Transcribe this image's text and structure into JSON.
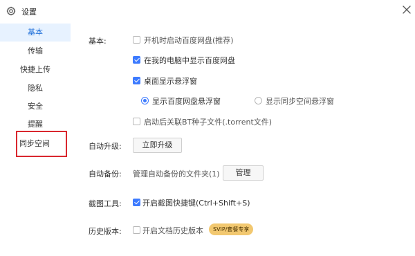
{
  "window": {
    "title": "设置"
  },
  "sidebar": {
    "items": [
      {
        "label": "基本",
        "active": true
      },
      {
        "label": "传输",
        "active": false
      },
      {
        "label": "快捷上传",
        "active": false
      },
      {
        "label": "隐私",
        "active": false
      },
      {
        "label": "安全",
        "active": false
      },
      {
        "label": "提醒",
        "active": false
      },
      {
        "label": "同步空间",
        "active": false
      }
    ]
  },
  "basic": {
    "section_label": "基本:",
    "options": [
      {
        "label": "开机时启动百度网盘(推荐)",
        "checked": false
      },
      {
        "label": "在我的电脑中显示百度网盘",
        "checked": true
      },
      {
        "label": "桌面显示悬浮窗",
        "checked": true
      }
    ],
    "float_radios": [
      {
        "label": "显示百度网盘悬浮窗",
        "selected": true
      },
      {
        "label": "显示同步空间悬浮窗",
        "selected": false
      }
    ],
    "bt_option": {
      "label": "启动后关联BT种子文件(.torrent文件)",
      "checked": false
    }
  },
  "upgrade": {
    "section_label": "自动升级:",
    "button_label": "立即升级"
  },
  "backup": {
    "section_label": "自动备份:",
    "description": "管理自动备份的文件夹(1)",
    "button_label": "管理"
  },
  "screenshot": {
    "section_label": "截图工具:",
    "option_label": "开启截图快捷键(Ctrl+Shift+S)",
    "checked": true
  },
  "history": {
    "section_label": "历史版本:",
    "option_label": "开启文档历史版本",
    "checked": false,
    "badge": "SVIP/套餐专享"
  },
  "colors": {
    "accent": "#3d7bff",
    "active_bg": "#e7f2ff",
    "highlight": "#d9272e",
    "badge_bg": "#f2c870"
  }
}
